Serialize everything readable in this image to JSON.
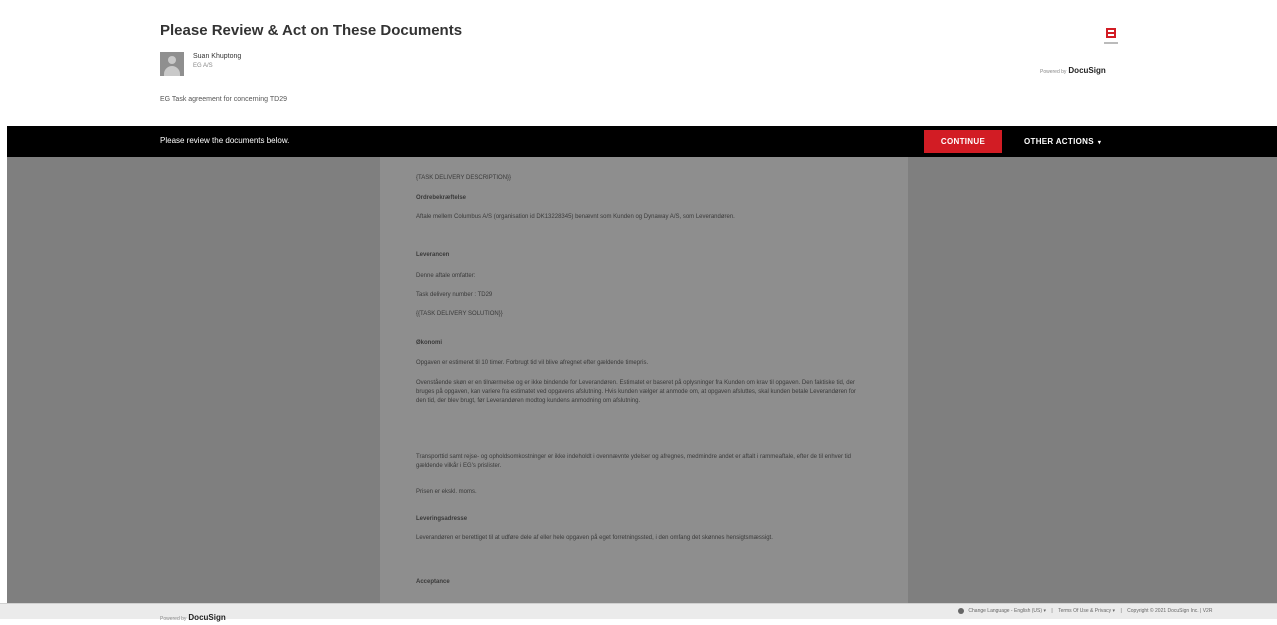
{
  "header": {
    "title": "Please Review & Act on These Documents",
    "sender": {
      "name": "Suan Khuptong",
      "company": "EG A/S"
    },
    "subject": "EG Task agreement for  concerning TD29",
    "powered_by": "Powered by",
    "brand": "DocuSign",
    "icons": [
      "company-logo-icon",
      "avatar-icon"
    ],
    "accent_color": "#d21c24"
  },
  "action_bar": {
    "message": "Please review the documents below.",
    "continue_label": "CONTINUE",
    "other_actions_label": "OTHER ACTIONS",
    "caret": "▾"
  },
  "document": {
    "lines": [
      {
        "text": "{TASK DELIVERY DESCRIPTION}}",
        "bold": false
      },
      {
        "text": "Ordrebekræftelse",
        "bold": true
      },
      {
        "text": "Aftale mellem Columbus A/S (organisation id DK13228345) benævnt som Kunden og Dynaway A/S, som Leverandøren.",
        "bold": false
      },
      {
        "text": "Leverancen",
        "bold": true
      },
      {
        "text": "Denne aftale omfatter:",
        "bold": false
      },
      {
        "text": "Task delivery number : TD29",
        "bold": false
      },
      {
        "text": "{{TASK DELIVERY SOLUTION}}",
        "bold": false
      },
      {
        "text": "Økonomi",
        "bold": true
      },
      {
        "text": "Opgaven er estimeret til 10 timer. Forbrugt tid vil blive afregnet efter gældende timepris.",
        "bold": false
      },
      {
        "text": "Ovenstående skøn er en tilnærmelse og er ikke bindende for Leverandøren. Estimatet er baseret på oplysninger fra Kunden om krav til opgaven. Den faktiske tid, der bruges på opgaven, kan variere fra estimatet ved opgavens afslutning. Hvis kunden vælger at anmode om, at opgaven afsluttes, skal kunden betale Leverandøren for den tid, der blev brugt, før Leverandøren modtog kundens anmodning om afslutning.",
        "bold": false
      },
      {
        "text": "Transporttid samt rejse- og opholdsomkostninger er ikke indeholdt i ovennævnte ydelser og afregnes, medmindre andet er aftalt i rammeaftale, efter de til enhver tid gældende vilkår i EG's prislister.",
        "bold": false
      },
      {
        "text": "Prisen er ekskl. moms.",
        "bold": false
      },
      {
        "text": "Leveringsadresse",
        "bold": true
      },
      {
        "text": "Leverandøren er berettiget til at udføre dele af eller hele opgaven på eget forretningssted, i den omfang det skønnes hensigtsmæssigt.",
        "bold": false
      },
      {
        "text": "Acceptance",
        "bold": true
      }
    ]
  },
  "footer": {
    "powered_by": "Powered by",
    "brand": "DocuSign",
    "change_language": "Change Language - English (US)",
    "terms": "Terms Of Use & Privacy",
    "copyright": "Copyright © 2021 DocuSign Inc. | V2R",
    "caret": "▾",
    "separator": "|"
  }
}
